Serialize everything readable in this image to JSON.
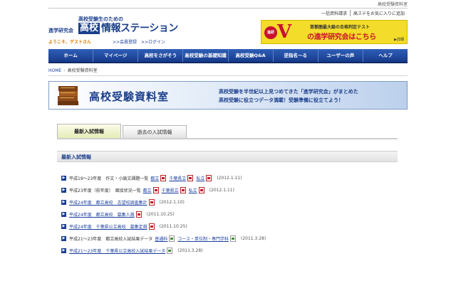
{
  "page_label": "高校受験資料室",
  "header": {
    "logo_sub": "高校受験生のための",
    "logo_pre": "進学研究会",
    "logo_box": "高校",
    "logo_text": "情報ステーション",
    "welcome": "ようこそ、ゲストさん",
    "member_link": ">>会員登録",
    "login_link": ">>ログイン",
    "util_links": [
      "一括資料請求",
      "高ステをお気に入りに追加"
    ]
  },
  "ad": {
    "badge": "進研",
    "v": "V",
    "line1": "首都圏最大級の合格判定テスト",
    "line2": "の進学研究会はこちら",
    "more": "▶詳細"
  },
  "nav": [
    "ホーム",
    "マイページ",
    "高校をさがそう",
    "高校受験の基礎知識",
    "高校受験Q&A",
    "逆指名～る",
    "ユーザーの声",
    "ヘルプ"
  ],
  "breadcrumb": {
    "home": "HOME",
    "sep": "›",
    "current": "高校受験資料室"
  },
  "banner": {
    "title": "高校受験資料室",
    "desc1": "高校受験を半世紀以上見つめてきた「進学研究会」がまとめた",
    "desc2": "高校受験に役立つデータ満載！受験準備に役立てよう！"
  },
  "tabs": [
    {
      "label": "最新入試情報",
      "active": true
    },
    {
      "label": "過去の入試情報",
      "active": false
    }
  ],
  "section_title": "最新入試情報",
  "items": [
    {
      "label": "平成19～23年度　作文・小論文課題一覧",
      "link": false,
      "files": [
        {
          "name": "都立",
          "type": "pdf"
        },
        {
          "name": "千葉県立",
          "type": "pdf"
        },
        {
          "name": "私立",
          "type": "pdf"
        }
      ],
      "date": "(2012.1.11)"
    },
    {
      "label": "平成23年度（前年度）　面接状況一覧",
      "link": false,
      "files": [
        {
          "name": "都立",
          "type": "pdf"
        },
        {
          "name": "千葉県立",
          "type": "pdf"
        },
        {
          "name": "私立",
          "type": "pdf"
        }
      ],
      "date": "(2012.1.11)"
    },
    {
      "label": "平成24年度　都立高校　志望校調査集計",
      "link": true,
      "files": [
        {
          "name": "",
          "type": "pdf"
        }
      ],
      "date": "(2012.1.10)"
    },
    {
      "label": "平成24年度　都立高校　募集人員",
      "link": true,
      "files": [
        {
          "name": "",
          "type": "pdf"
        }
      ],
      "date": "(2011.10.25)"
    },
    {
      "label": "平成24年度　千葉県公立高校　募集定員",
      "link": true,
      "files": [
        {
          "name": "",
          "type": "pdf"
        }
      ],
      "date": "(2011.10.25)"
    },
    {
      "label": "平成21～23年度　都立高校入試結果データ",
      "link": false,
      "files": [
        {
          "name": "普通科",
          "type": "xls"
        },
        {
          "name": "コース・単位制・専門学科",
          "type": "xls"
        }
      ],
      "date": "(2011.3.28)"
    },
    {
      "label": "平成21～23年度　千葉県公立高校入試結果データ",
      "link": true,
      "files": [
        {
          "name": "",
          "type": "xls"
        }
      ],
      "date": "(2011.3.28)"
    }
  ]
}
